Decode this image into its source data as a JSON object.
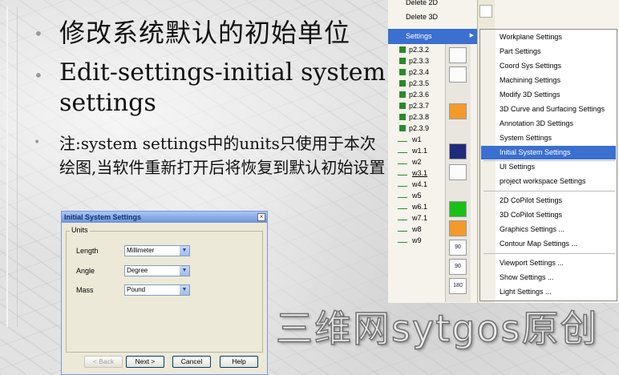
{
  "slide": {
    "title_cn": "修改系统默认的初始单位",
    "subtitle": "Edit-settings-initial system settings",
    "note": "注:system settings中的units只使用于本次绘图,当软件重新打开后将恢复到默认初始设置",
    "bullets": [
      "•",
      "•",
      "•"
    ]
  },
  "dialog": {
    "title": "Initial System Settings",
    "close": "×",
    "group_label": "Units",
    "fields": [
      {
        "label": "Length",
        "value": "Millimeter"
      },
      {
        "label": "Angle",
        "value": "Degree"
      },
      {
        "label": "Mass",
        "value": "Pound"
      }
    ],
    "buttons": {
      "back": "< Back",
      "next": "Next >",
      "cancel": "Cancel",
      "help": "Help"
    }
  },
  "menu": {
    "top_items": [
      "Delete 2D",
      "Delete 3D"
    ],
    "settings": "Settings",
    "settings_arrow": "▶",
    "submenu": [
      "Workplane Settings",
      "Part Settings",
      "Coord Sys Settings",
      "Machining Settings",
      "Modify 3D Settings",
      "3D Curve and Surfacing Settings",
      "Annotation 3D Settings",
      "System Settings",
      "Initial System Settings",
      "UI Settings",
      "project workspace Settings",
      "2D CoPilot Settings",
      "3D CoPilot Settings",
      "Graphics Settings ...",
      "Contour Map Settings ...",
      "Viewport Settings ...",
      "Show Settings ...",
      "Light Settings ..."
    ],
    "highlighted": "Initial System Settings"
  },
  "tree": {
    "items": [
      "p2.3.2",
      "p2.3.3",
      "p2.3.4",
      "p2.3.5",
      "p2.3.6",
      "p2.3.7",
      "p2.3.8",
      "p2.3.9",
      "w1",
      "w1.1",
      "w2",
      "w3.1",
      "w4.1",
      "w5",
      "w6.1",
      "w7.1",
      "w8",
      "w9"
    ]
  },
  "toolbar": {
    "rotate_labels": [
      "90",
      "90",
      "180"
    ]
  },
  "watermark": "三维网sytgos原创"
}
